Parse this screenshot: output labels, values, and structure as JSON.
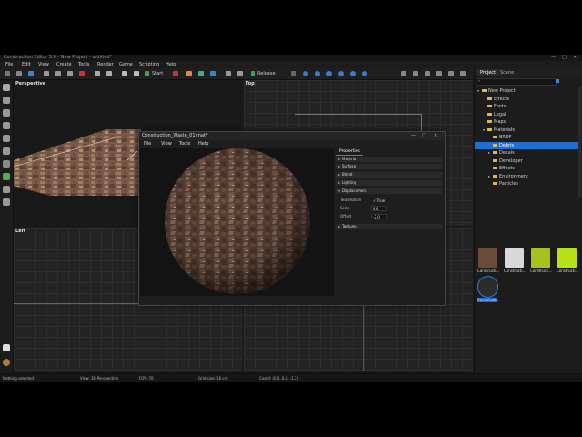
{
  "window": {
    "title": "Construction Editor 5.0 - New Project - untitled*"
  },
  "menu": [
    "File",
    "Edit",
    "View",
    "Create",
    "Tools",
    "Render",
    "Game",
    "Scripting",
    "Help"
  ],
  "toolbar": {
    "play_label": "Start",
    "mode_label": "Release"
  },
  "viewports": {
    "perspective": "Perspective",
    "top": "Top",
    "left": "Left"
  },
  "project_panel": {
    "tabs": [
      "Project",
      "Scene"
    ],
    "tree": [
      {
        "label": "New Project",
        "level": 0
      },
      {
        "label": "Effects",
        "level": 1
      },
      {
        "label": "Fonts",
        "level": 1
      },
      {
        "label": "Legal",
        "level": 1
      },
      {
        "label": "Maps",
        "level": 1
      },
      {
        "label": "Materials",
        "level": 1
      },
      {
        "label": "BRDF",
        "level": 2
      },
      {
        "label": "Debris",
        "level": 2,
        "selected": true
      },
      {
        "label": "Decals",
        "level": 2
      },
      {
        "label": "Developer",
        "level": 2
      },
      {
        "label": "Effects",
        "level": 2
      },
      {
        "label": "Environment",
        "level": 2
      },
      {
        "label": "Particles",
        "level": 2
      }
    ],
    "assets": [
      {
        "label": "Constructi...",
        "color": "#6b4a3a"
      },
      {
        "label": "Constructi...",
        "color": "#d8d8d8"
      },
      {
        "label": "Constructi...",
        "color": "#a9c21b"
      },
      {
        "label": "Constructi...",
        "color": "#b6e21a"
      },
      {
        "label": "Constructi...",
        "color": "#2b2b2b",
        "selected": true
      }
    ]
  },
  "dialog": {
    "title": "Construction_Waste_01.mat*",
    "menu": [
      "File",
      "View",
      "Tools",
      "Help"
    ],
    "properties_tab": "Properties",
    "sections": [
      "Material",
      "Surface",
      "Blend",
      "Lighting",
      "Displacement",
      "Textures"
    ],
    "displacement": {
      "tessellation_label": "Tessellation",
      "tessellation_value": "True",
      "scale_label": "Scale",
      "scale_value": "4.0",
      "offset_label": "Offset",
      "offset_value": "-2.0"
    }
  },
  "statusbar": {
    "selection": "Nothing selected",
    "view": "View: 3D Perspective",
    "fov": "FOV: 70",
    "grid": "Grid size: 16 cm",
    "coords": "Coord: (0.0, 0.0, -1.2)"
  },
  "colors": {
    "accent": "#2e7fd8",
    "selection": "#1f6fd1",
    "folder": "#e0b94a"
  }
}
